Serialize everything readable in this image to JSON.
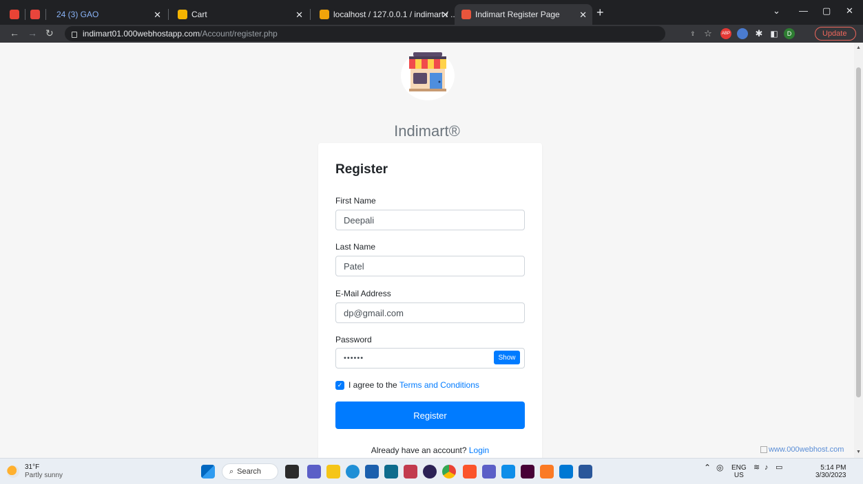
{
  "browser": {
    "tabs": [
      {
        "label": "24 (3) GAO"
      },
      {
        "label": "Cart"
      },
      {
        "label": "localhost / 127.0.0.1 / indimart / ..."
      },
      {
        "label": "Indimart Register Page"
      }
    ],
    "url_host": "indimart01.000webhostapp.com",
    "url_path": "/Account/register.php",
    "update_label": "Update",
    "profile_initial": "D",
    "abp_label": "ABP"
  },
  "page": {
    "brand": "Indimart®",
    "card_title": "Register",
    "first_name_label": "First Name",
    "first_name_value": "Deepali",
    "last_name_label": "Last Name",
    "last_name_value": "Patel",
    "email_label": "E-Mail Address",
    "email_value": "dp@gmail.com",
    "password_label": "Password",
    "password_value": "••••••",
    "show_label": "Show",
    "agree_text": "I agree to the ",
    "terms_link": "Terms and Conditions",
    "register_button": "Register",
    "already_text": "Already have an account? ",
    "login_link": "Login",
    "webhost_text": "www.000webhost.com"
  },
  "taskbar": {
    "temperature": "31°F",
    "weather": "Partly sunny",
    "search_label": "Search",
    "lang_top": "ENG",
    "lang_bottom": "US",
    "time": "5:14 PM",
    "date": "3/30/2023"
  },
  "colors": {
    "primary": "#007bff",
    "update": "#ee675c"
  }
}
